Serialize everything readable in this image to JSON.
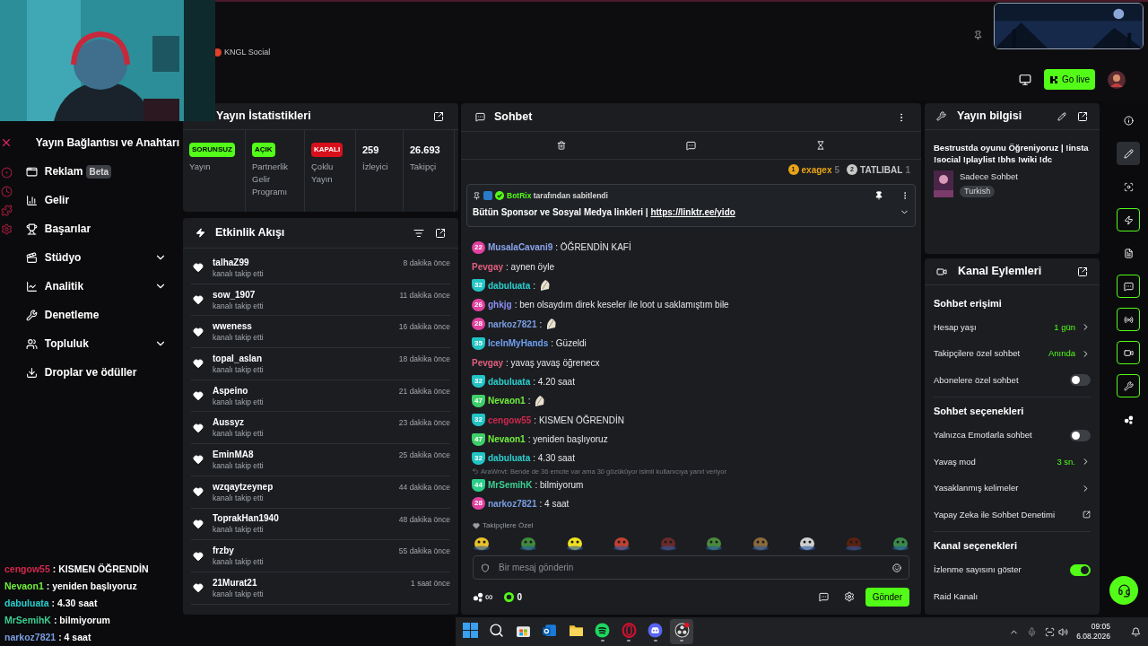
{
  "header": {
    "source_label": "KNGL Social",
    "go_live": "Go live"
  },
  "sidebar": {
    "title": "Yayın Bağlantısı ve Anahtarı",
    "items": [
      {
        "kind": "ad",
        "label": "Reklam",
        "badge": "Beta",
        "expandable": false
      },
      {
        "kind": "revenue",
        "label": "Gelir",
        "expandable": false
      },
      {
        "kind": "achievements",
        "label": "Başarılar",
        "expandable": false
      },
      {
        "kind": "studio",
        "label": "Stüdyo",
        "expandable": true
      },
      {
        "kind": "analytics",
        "label": "Analitik",
        "expandable": true
      },
      {
        "kind": "moderation",
        "label": "Denetleme",
        "expandable": false
      },
      {
        "kind": "community",
        "label": "Topluluk",
        "expandable": true
      },
      {
        "kind": "drops",
        "label": "Droplar ve ödüller",
        "expandable": false
      }
    ]
  },
  "overlay_chat": [
    {
      "user": "cengow55",
      "color": "#d0284e",
      "text": ": KISMEN ÖĞRENDİN"
    },
    {
      "user": "Nevaon1",
      "color": "#72f03c",
      "text": ": yeniden başlıyoruz"
    },
    {
      "user": "dabuluata",
      "color": "#2ad0d0",
      "text": ": 4.30 saat"
    },
    {
      "user": "MrSemihK",
      "color": "#3ccf92",
      "text": ": bilmiyorum"
    },
    {
      "user": "narkoz7821",
      "color": "#7a9ee0",
      "text": ": 4 saat"
    }
  ],
  "stats": {
    "title": "Yayın İstatistikleri",
    "cells": [
      {
        "kind": "status",
        "value": "SORUNSUZ",
        "on": true,
        "label": "Yayın"
      },
      {
        "kind": "status",
        "value": "AÇIK",
        "on": true,
        "label": "Partnerlik Gelir Programı"
      },
      {
        "kind": "status",
        "value": "KAPALI",
        "on": false,
        "label": "Çoklu Yayın"
      },
      {
        "kind": "count",
        "value": "259",
        "label": "İzleyici"
      },
      {
        "kind": "count",
        "value": "26.693",
        "label": "Takipçi"
      }
    ]
  },
  "events": {
    "title": "Etkinlik Akışı",
    "rows": [
      {
        "user": "talhaZ99",
        "action": "kanalı takip etti",
        "time": "8 dakika önce"
      },
      {
        "user": "sow_1907",
        "action": "kanalı takip etti",
        "time": "11 dakika önce"
      },
      {
        "user": "wweness",
        "action": "kanalı takip etti",
        "time": "16 dakika önce"
      },
      {
        "user": "topal_aslan",
        "action": "kanalı takip etti",
        "time": "18 dakika önce"
      },
      {
        "user": "Aspeino",
        "action": "kanalı takip etti",
        "time": "21 dakika önce"
      },
      {
        "user": "Aussyz",
        "action": "kanalı takip etti",
        "time": "23 dakika önce"
      },
      {
        "user": "EminMA8",
        "action": "kanalı takip etti",
        "time": "25 dakika önce"
      },
      {
        "user": "wzqaytzeynep",
        "action": "kanalı takip etti",
        "time": "44 dakika önce"
      },
      {
        "user": "ToprakHan1940",
        "action": "kanalı takip etti",
        "time": "48 dakika önce"
      },
      {
        "user": "frzby",
        "action": "kanalı takip etti",
        "time": "55 dakika önce"
      },
      {
        "user": "21Murat21",
        "action": "kanalı takip etti",
        "time": "1 saat önce"
      }
    ]
  },
  "chat": {
    "title": "Sohbet",
    "leaderboard": [
      {
        "rank": "1",
        "user": "exagex",
        "count": "5",
        "color": "#e8a317"
      },
      {
        "rank": "2",
        "user": "TATLIBAL",
        "count": "1",
        "color": "#c8c8c8"
      }
    ],
    "pinned": {
      "by": "BotRix",
      "by_suffix": "tarafından sabitlendi",
      "text": "Bütün Sponsor ve Sosyal Medya linkleri | ",
      "link": "https://linktr.ee/yido"
    },
    "messages": [
      {
        "kind": "text",
        "badge": {
          "number": "22",
          "kind": "drop",
          "color": "#e2409f"
        },
        "user": {
          "name": "MusalaCavani9",
          "color": "#8aa4ec"
        },
        "text": ": ÖĞRENDİN KAFİ"
      },
      {
        "kind": "text",
        "user": {
          "name": "Pevgay",
          "color": "#e0607e"
        },
        "text": ": aynen öyle"
      },
      {
        "kind": "emote",
        "badge": {
          "number": "32",
          "kind": "shield",
          "color": "#22c4c4"
        },
        "user": {
          "name": "dabuluata",
          "color": "#2ad0d0"
        },
        "text": ":"
      },
      {
        "kind": "text",
        "badge": {
          "number": "26",
          "kind": "drop",
          "color": "#e2409f"
        },
        "user": {
          "name": "ghkjg",
          "color": "#8c8ef2"
        },
        "text": ": ben olsaydım direk keseler ile loot u saklamıştım bile"
      },
      {
        "kind": "emote",
        "badge": {
          "number": "28",
          "kind": "drop",
          "color": "#e2409f"
        },
        "user": {
          "name": "narkoz7821",
          "color": "#7a9ee0"
        },
        "text": ":"
      },
      {
        "kind": "text",
        "badge": {
          "number": "35",
          "kind": "shield",
          "color": "#22c4c4"
        },
        "user": {
          "name": "IceInMyHands",
          "color": "#6fa0f0"
        },
        "text": ": Güzeldi"
      },
      {
        "kind": "text",
        "user": {
          "name": "Pevgay",
          "color": "#e0607e"
        },
        "text": ": yavaş yavaş öğrenecx"
      },
      {
        "kind": "text",
        "badge": {
          "number": "32",
          "kind": "shield",
          "color": "#22c4c4"
        },
        "user": {
          "name": "dabuluata",
          "color": "#2ad0d0"
        },
        "text": ": 4.20 saat"
      },
      {
        "kind": "emote",
        "badge": {
          "number": "47",
          "kind": "shield",
          "color": "#3fcf6a"
        },
        "user": {
          "name": "Nevaon1",
          "color": "#72f03c"
        },
        "text": ":"
      },
      {
        "kind": "text",
        "badge": {
          "number": "32",
          "kind": "shield",
          "color": "#22c4c4"
        },
        "user": {
          "name": "cengow55",
          "color": "#d0284e"
        },
        "text": ": KISMEN ÖĞRENDİN"
      },
      {
        "kind": "text",
        "badge": {
          "number": "47",
          "kind": "shield",
          "color": "#3fcf6a"
        },
        "user": {
          "name": "Nevaon1",
          "color": "#72f03c"
        },
        "text": ": yeniden başlıyoruz"
      },
      {
        "kind": "text",
        "badge": {
          "number": "32",
          "kind": "shield",
          "color": "#22c4c4"
        },
        "user": {
          "name": "dabuluata",
          "color": "#2ad0d0"
        },
        "text": ": 4.30 saat"
      },
      {
        "kind": "text",
        "reply_to": "AraWnvt: Bende de 36 emote var ama 30 gözüküyor isimli kullanıcıya yanıt veriyor",
        "badge": {
          "number": "44",
          "kind": "shield",
          "color": "#2ccf8a"
        },
        "user": {
          "name": "MrSemihK",
          "color": "#3ccf92"
        },
        "text": ": bilmiyorum"
      },
      {
        "kind": "text",
        "badge": {
          "number": "28",
          "kind": "drop",
          "color": "#e2409f"
        },
        "user": {
          "name": "narkoz7821",
          "color": "#7a9ee0"
        },
        "text": ": 4 saat"
      }
    ],
    "follower_label": "Takipçilere Özel",
    "input": {
      "placeholder": "Bir mesaj gönderin"
    },
    "infinity": "∞",
    "coins": "0",
    "send": "Gönder"
  },
  "stream_info": {
    "title": "Yayın bilgisi",
    "stream_title": "Bestrustda oyunu Öğreniyoruz | !insta !social !playlist !bhs !wiki !dc",
    "category": "Sadece Sohbet",
    "tag": "Turkish"
  },
  "channel_actions": {
    "title": "Kanal Eylemleri",
    "sections": [
      {
        "heading": "Sohbet erişimi",
        "rows": [
          {
            "kind": "value",
            "label": "Hesap yaşı",
            "value": "1 gün"
          },
          {
            "kind": "value",
            "label": "Takipçilere özel sohbet",
            "value": "Anında"
          },
          {
            "kind": "toggle",
            "label": "Abonelere özel sohbet",
            "on": false
          }
        ]
      },
      {
        "heading": "Sohbet seçenekleri",
        "rows": [
          {
            "kind": "toggle",
            "label": "Yalnızca Emotlarla sohbet",
            "on": false
          },
          {
            "kind": "value",
            "label": "Yavaş mod",
            "value": "3 sn."
          },
          {
            "kind": "link",
            "label": "Yasaklanmış kelimeler"
          },
          {
            "kind": "external",
            "label": "Yapay Zeka ile Sohbet Denetimi"
          }
        ]
      },
      {
        "heading": "Kanal seçenekleri",
        "rows": [
          {
            "kind": "toggle",
            "label": "İzlenme sayısını göster",
            "on": true
          },
          {
            "kind": "plain",
            "label": "Raid Kanalı"
          }
        ]
      }
    ]
  },
  "rail": [
    {
      "kind": "info",
      "selected": false,
      "active": false
    },
    {
      "kind": "pencil",
      "selected": true,
      "active": false
    },
    {
      "kind": "focus",
      "selected": false,
      "active": false
    },
    {
      "kind": "bolt",
      "selected": false,
      "active": true
    },
    {
      "kind": "document",
      "selected": false,
      "active": false
    },
    {
      "kind": "chat",
      "selected": false,
      "active": true
    },
    {
      "kind": "broadcast",
      "selected": false,
      "active": true
    },
    {
      "kind": "camera",
      "selected": false,
      "active": true
    },
    {
      "kind": "wrench",
      "selected": false,
      "active": true
    },
    {
      "kind": "dots",
      "selected": false,
      "active": false
    }
  ],
  "taskbar": {
    "apps": [
      {
        "kind": "start",
        "running": false,
        "selected": false
      },
      {
        "kind": "search",
        "running": false,
        "selected": false
      },
      {
        "kind": "store",
        "running": false,
        "selected": false
      },
      {
        "kind": "mail",
        "running": false,
        "selected": false
      },
      {
        "kind": "folder",
        "running": false,
        "selected": false
      },
      {
        "kind": "music",
        "running": true,
        "selected": false
      },
      {
        "kind": "browser",
        "running": true,
        "selected": false
      },
      {
        "kind": "voice",
        "running": true,
        "selected": false
      },
      {
        "kind": "recorder",
        "running": true,
        "selected": true
      }
    ],
    "time": "09:05",
    "date": "6.08.2026"
  }
}
